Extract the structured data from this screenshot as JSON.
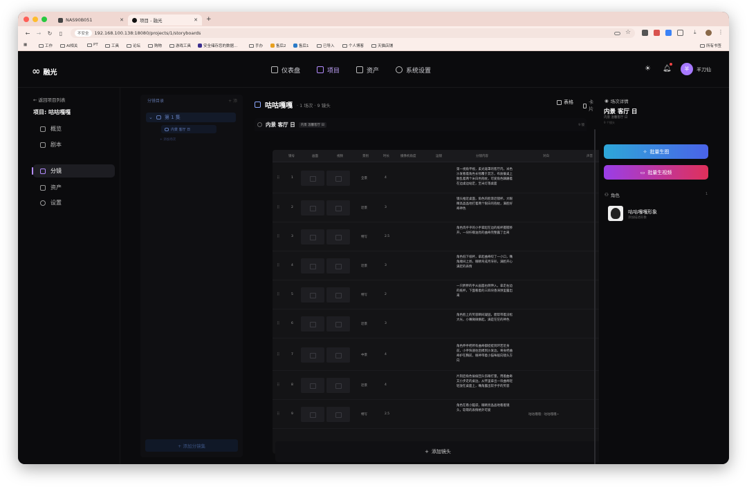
{
  "browser": {
    "tabs": [
      {
        "title": "NAS90B051",
        "active": false
      },
      {
        "title": "项目 - 融光",
        "active": true
      }
    ],
    "new_tab": "+",
    "security_badge": "不安全",
    "url": "192.168.100.138:18080/projects/1/storyboards",
    "bookmarks": [
      "工作",
      "AI相关",
      "PT",
      "工具",
      "论坛",
      "购物",
      "游戏工具",
      "安全储存您的数据...",
      "手办",
      "售后2",
      "售后1",
      "已导入",
      "个人博客",
      "天猫店铺"
    ],
    "all_bookmarks": "所有书签"
  },
  "app": {
    "brand": "融光",
    "nav": [
      {
        "label": "仪表盘",
        "active": false
      },
      {
        "label": "项目",
        "active": true
      },
      {
        "label": "资产",
        "active": false
      },
      {
        "label": "系统设置",
        "active": false
      }
    ],
    "user_avatar": "羊",
    "user_name": "羊刀仙"
  },
  "sidebar": {
    "back": "返回项目列表",
    "project": "项目: 咕咕嘎嘎",
    "items": [
      {
        "label": "概览",
        "active": false
      },
      {
        "label": "剧本",
        "active": false
      },
      {
        "label": "分镜",
        "active": true
      },
      {
        "label": "资产",
        "active": false
      },
      {
        "label": "设置",
        "active": false
      }
    ]
  },
  "shot_panel": {
    "title": "分镜目录",
    "action": "+ 添",
    "scene": "第 1 集",
    "subscene": "内景 客厅 日",
    "add_scene": "+ 添加场次",
    "add_group": "+ 添加分镜集"
  },
  "main": {
    "title": "咕咕嘎嘎",
    "subtitle": "· 1 场次 · 9 镜头",
    "view_table": "表格",
    "view_card": "卡片",
    "scene_title": "内景 客厅 日",
    "scene_tag": "内景 温馨客厅 日",
    "scene_count": "9 镜",
    "columns": [
      "镜号",
      "画面",
      "视频",
      "景别",
      "时长",
      "摄像机角度",
      "运镜",
      "分镜内容",
      "对白",
      "声音"
    ],
    "rows": [
      {
        "no": "1",
        "shot": "全景",
        "dur": "4",
        "desc": "第一视角平视，柔光笼罩的客厅内，米色沙发看着角色长毯覆于其方，布质餐桌上散乱着两个米白色抱枕，可爱角色蹒跚着在边桌边站定，至米灯落桌面",
        "dialogue": ""
      },
      {
        "no": "2",
        "shot": "近景",
        "dur": "3",
        "desc": "镜头推近桌面，角色的脸渐近镜杯，大眼睛高晶晶地打着两个银白的抱枕，满脸好奇神色",
        "dialogue": ""
      },
      {
        "no": "3",
        "shot": "特写",
        "dur": "2.5",
        "desc": "角色肉乎乎的小手掌起在边的纸杯握握移开，一块柠檬油亮的曲奇完整露了出来",
        "dialogue": ""
      },
      {
        "no": "4",
        "shot": "近景",
        "dur": "3",
        "desc": "角色低下纸杯，拿起曲奇咬了一小口，嘴角顺间上扬，眼睛弯成月牙形，满脸开心满足的表情",
        "dialogue": ""
      },
      {
        "no": "5",
        "shot": "特写",
        "dur": "2",
        "desc": "一只胖胖的手从画面右侧伸入，拿走右边的纸杯，下面看着的三四块香涛饼里露出来",
        "dialogue": ""
      },
      {
        "no": "6",
        "shot": "近景",
        "dur": "3",
        "desc": "角色脸上的笑容瞬间凝固，腮帮带着没松大光，小嘴微微撅起，满是茫茫的神色",
        "dialogue": ""
      },
      {
        "no": "7",
        "shot": "中景",
        "dur": "4",
        "desc": "角色伸手把所有曲奇都挺挺到环若近身前，小手快速往后摸到沙发边，将身把曲奇护在胸前，眼神带着小猫咪般向镜头方向",
        "dialogue": ""
      },
      {
        "no": "8",
        "shot": "近景",
        "dur": "4",
        "desc": "片刻后角色偷偷回头伤眼打量，用着曲奇又小步走的桌边，从怀里拿出一块曲奇轻轻放在桌面上，嘴角露出软乎乎的笑容",
        "dialogue": ""
      },
      {
        "no": "9",
        "shot": "特写",
        "dur": "2.5",
        "desc": "角色在看小脑袋，眼睛亮晶晶地看着镜头，软萌的表情格外可爱",
        "dialogue": "咕咕嘎嘎：咕咕嘎嘎~"
      }
    ],
    "add_shot": "添加镜头"
  },
  "detail": {
    "label": "场次详情",
    "title": "内景 客厅 日",
    "tag": "内景 温馨客厅 日",
    "count": "9 个镜头",
    "btn_image": "批量生图",
    "btn_video": "批量生视频",
    "roles_label": "角色",
    "roles_count": "1",
    "character_name": "咕咕嘎嘎形象",
    "character_sub": "添加描述形象"
  },
  "colors": {
    "accent": "#b48cff",
    "btn_image_from": "#2ea7d8",
    "btn_image_to": "#4a63e8",
    "btn_video_from": "#9a3ee8",
    "btn_video_to": "#e0305a"
  }
}
